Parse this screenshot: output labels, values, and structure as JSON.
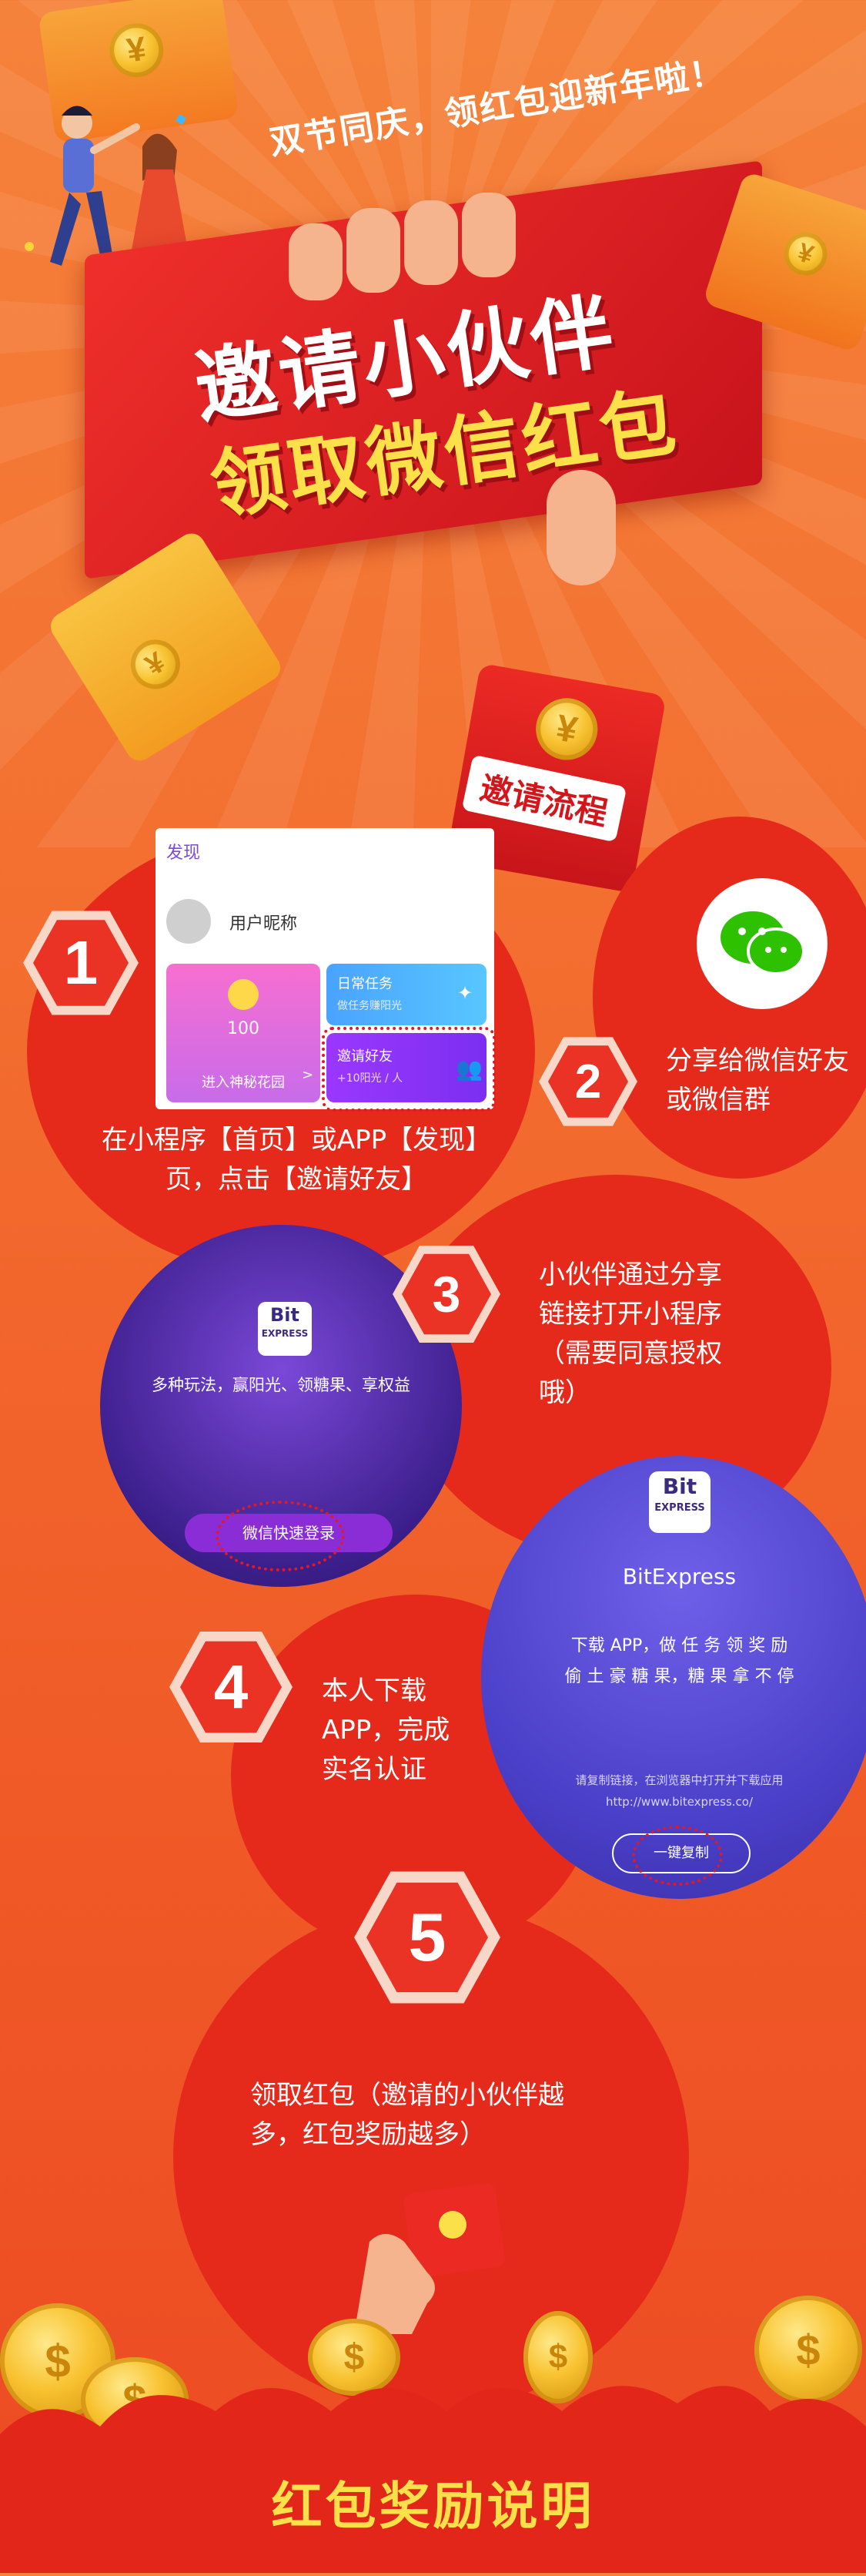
{
  "banner": {
    "subtitle": "双节同庆，领红包迎新年啦！",
    "title_line1": "邀请小伙伴",
    "title_line2": "领取微信红包",
    "yuan": "¥"
  },
  "process_badge": "邀请流程",
  "step1": {
    "number": "1",
    "text": "在小程序【首页】或APP【发现】页，点击【邀请好友】",
    "screen": {
      "tab": "发现",
      "nickname": "用户昵称",
      "sun_value": "100",
      "garden": "进入神秘花园",
      "daily_title": "日常任务",
      "daily_sub": "做任务赚阳光",
      "invite_title": "邀请好友",
      "invite_sub": "+10阳光 / 人",
      "arrow": ">"
    }
  },
  "step2": {
    "number": "2",
    "text": "分享给微信好友或微信群"
  },
  "step3": {
    "number": "3",
    "text": "小伙伴通过分享链接打开小程序（需要同意授权哦）",
    "screen": {
      "logo_top": "Bit",
      "logo_bottom": "EXPRESS",
      "slogan": "多种玩法，赢阳光、领糖果、享权益",
      "login": "微信快速登录"
    }
  },
  "step4": {
    "number": "4",
    "text": "本人下载APP，完成实名认证",
    "screen": {
      "logo_top": "Bit",
      "logo_bottom": "EXPRESS",
      "brand": "BitExpress",
      "line1": "下载 APP，做 任 务 领 奖 励",
      "line2": "偷 土 豪 糖 果，糖 果 拿 不 停",
      "hint": "请复制链接，在浏览器中打开并下载应用",
      "url": "http://www.bitexpress.co/",
      "copy": "一键复制"
    }
  },
  "step5": {
    "number": "5",
    "text": "领取红包（邀请的小伙伴越多，红包奖励越多）"
  },
  "footer_title": "红包奖励说明",
  "colors": {
    "accent_red": "#e52a1c",
    "gold": "#fbe04a",
    "wechat_green": "#2dc100"
  }
}
